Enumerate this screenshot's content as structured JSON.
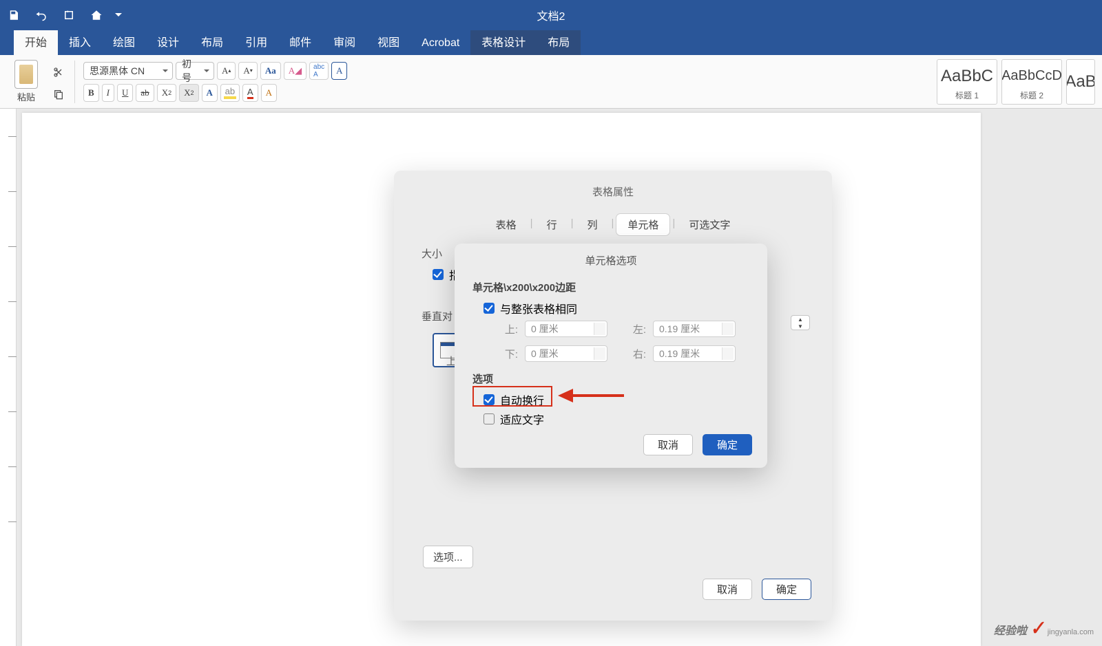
{
  "window": {
    "title": "文档2"
  },
  "qat": {
    "save": "save-icon",
    "undo": "undo-icon",
    "redo": "redo-icon",
    "home": "home-icon",
    "customize": "chevron-down-icon"
  },
  "tabs": [
    {
      "label": "开始",
      "active": true
    },
    {
      "label": "插入"
    },
    {
      "label": "绘图"
    },
    {
      "label": "设计"
    },
    {
      "label": "布局"
    },
    {
      "label": "引用"
    },
    {
      "label": "邮件"
    },
    {
      "label": "审阅"
    },
    {
      "label": "视图"
    },
    {
      "label": "Acrobat"
    },
    {
      "label": "表格设计",
      "highlight": true
    },
    {
      "label": "布局",
      "highlight": true
    }
  ],
  "ribbon": {
    "paste_label": "粘贴",
    "font_name": "思源黑体 CN",
    "font_size": "初号",
    "style_samples": {
      "s1": "AaBbC",
      "s2": "AaBbCcD",
      "s3": "AaB"
    },
    "style_labels": {
      "l1": "标题 1",
      "l2": "标题 2"
    }
  },
  "dialog1": {
    "title": "表格属性",
    "tabs": {
      "table": "表格",
      "row": "行",
      "column": "列",
      "cell": "单元格",
      "alt": "可选文字"
    },
    "size_label": "大小",
    "prefer_checkbox_prefix": "指",
    "valign_label": "垂直对",
    "valign_option_top": "上",
    "options_button": "选项...",
    "cancel": "取消",
    "ok": "确定"
  },
  "dialog2": {
    "title": "单元格选项",
    "margins_label": "单元格\\x200\\x200边距",
    "same_as_table": "与整张表格相同",
    "top_label": "上:",
    "bottom_label": "下:",
    "left_label": "左:",
    "right_label": "右:",
    "top_value": "0 厘米",
    "bottom_value": "0 厘米",
    "left_value": "0.19 厘米",
    "right_value": "0.19 厘米",
    "options_label": "选项",
    "wrap_text": "自动换行",
    "fit_text": "适应文字",
    "cancel": "取消",
    "ok": "确定"
  },
  "watermark": {
    "text": "经验啦",
    "url": "jingyanla.com"
  }
}
